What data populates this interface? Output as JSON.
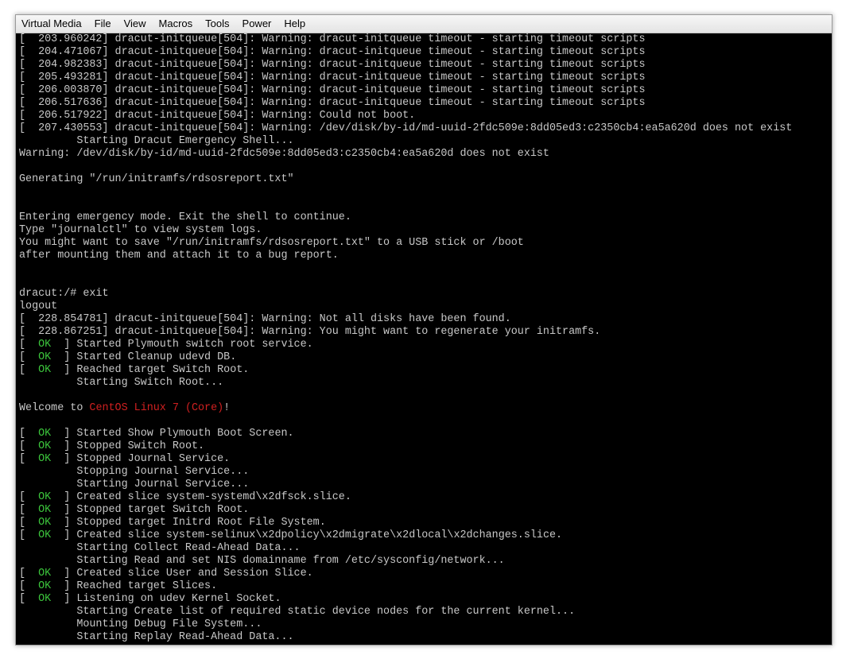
{
  "menubar": {
    "items": [
      "Virtual Media",
      "File",
      "View",
      "Macros",
      "Tools",
      "Power",
      "Help"
    ]
  },
  "colors": {
    "ok": "#3cc53c",
    "highlight": "#d02020",
    "text": "#c8c8c8",
    "background": "#000000"
  },
  "console": {
    "lines": [
      {
        "text": "[  203.960242] dracut-initqueue[504]: Warning: dracut-initqueue timeout - starting timeout scripts"
      },
      {
        "text": "[  204.471067] dracut-initqueue[504]: Warning: dracut-initqueue timeout - starting timeout scripts"
      },
      {
        "text": "[  204.982383] dracut-initqueue[504]: Warning: dracut-initqueue timeout - starting timeout scripts"
      },
      {
        "text": "[  205.493281] dracut-initqueue[504]: Warning: dracut-initqueue timeout - starting timeout scripts"
      },
      {
        "text": "[  206.003870] dracut-initqueue[504]: Warning: dracut-initqueue timeout - starting timeout scripts"
      },
      {
        "text": "[  206.517636] dracut-initqueue[504]: Warning: dracut-initqueue timeout - starting timeout scripts"
      },
      {
        "text": "[  206.517922] dracut-initqueue[504]: Warning: Could not boot."
      },
      {
        "text": "[  207.430553] dracut-initqueue[504]: Warning: /dev/disk/by-id/md-uuid-2fdc509e:8dd05ed3:c2350cb4:ea5a620d does not exist"
      },
      {
        "text": "         Starting Dracut Emergency Shell..."
      },
      {
        "text": "Warning: /dev/disk/by-id/md-uuid-2fdc509e:8dd05ed3:c2350cb4:ea5a620d does not exist"
      },
      {
        "text": ""
      },
      {
        "text": "Generating \"/run/initramfs/rdsosreport.txt\""
      },
      {
        "text": ""
      },
      {
        "text": ""
      },
      {
        "text": "Entering emergency mode. Exit the shell to continue."
      },
      {
        "text": "Type \"journalctl\" to view system logs."
      },
      {
        "text": "You might want to save \"/run/initramfs/rdsosreport.txt\" to a USB stick or /boot"
      },
      {
        "text": "after mounting them and attach it to a bug report."
      },
      {
        "text": ""
      },
      {
        "text": ""
      },
      {
        "text": "dracut:/# exit"
      },
      {
        "text": "logout"
      },
      {
        "text": "[  228.854781] dracut-initqueue[504]: Warning: Not all disks have been found."
      },
      {
        "text": "[  228.867251] dracut-initqueue[504]: Warning: You might want to regenerate your initramfs."
      },
      {
        "ok": true,
        "text": " Started Plymouth switch root service."
      },
      {
        "ok": true,
        "text": " Started Cleanup udevd DB."
      },
      {
        "ok": true,
        "text": " Reached target Switch Root."
      },
      {
        "text": "         Starting Switch Root..."
      },
      {
        "text": ""
      },
      {
        "welcome": true,
        "pre": "Welcome to ",
        "red": "CentOS Linux 7 (Core)",
        "post": "!"
      },
      {
        "text": ""
      },
      {
        "ok": true,
        "text": " Started Show Plymouth Boot Screen."
      },
      {
        "ok": true,
        "text": " Stopped Switch Root."
      },
      {
        "ok": true,
        "text": " Stopped Journal Service."
      },
      {
        "text": "         Stopping Journal Service..."
      },
      {
        "text": "         Starting Journal Service..."
      },
      {
        "ok": true,
        "text": " Created slice system-systemd\\x2dfsck.slice."
      },
      {
        "ok": true,
        "text": " Stopped target Switch Root."
      },
      {
        "ok": true,
        "text": " Stopped target Initrd Root File System."
      },
      {
        "ok": true,
        "text": " Created slice system-selinux\\x2dpolicy\\x2dmigrate\\x2dlocal\\x2dchanges.slice."
      },
      {
        "text": "         Starting Collect Read-Ahead Data..."
      },
      {
        "text": "         Starting Read and set NIS domainname from /etc/sysconfig/network..."
      },
      {
        "ok": true,
        "text": " Created slice User and Session Slice."
      },
      {
        "ok": true,
        "text": " Reached target Slices."
      },
      {
        "ok": true,
        "text": " Listening on udev Kernel Socket."
      },
      {
        "text": "         Starting Create list of required static device nodes for the current kernel..."
      },
      {
        "text": "         Mounting Debug File System..."
      },
      {
        "text": "         Starting Replay Read-Ahead Data..."
      }
    ]
  }
}
